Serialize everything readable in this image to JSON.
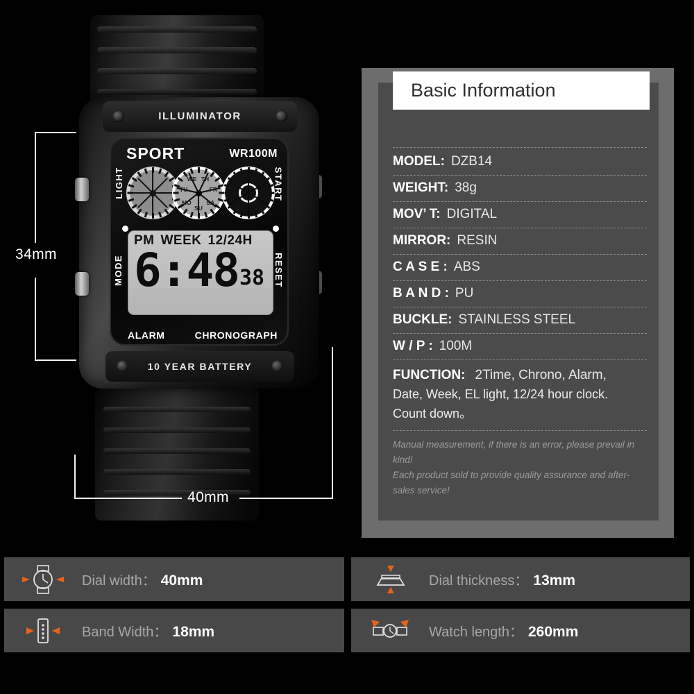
{
  "watch": {
    "bezel_top_text": "ILLUMINATOR",
    "bezel_bottom_text": "10 YEAR BATTERY",
    "face": {
      "brand": "SPORT",
      "water_resist": "WR100M",
      "button_light": "LIGHT",
      "button_start": "START",
      "button_mode": "MODE",
      "button_reset": "RESET",
      "label_alarm": "ALARM",
      "label_chronograph": "CHRONOGRAPH",
      "lcd": {
        "meridiem": "PM",
        "week_label": "WEEK",
        "format_label": "12/24H",
        "time": "6:48",
        "seconds": "38"
      },
      "weekdays": [
        "SU",
        "MO",
        "TU",
        "WE",
        "TH",
        "FR",
        "SA"
      ]
    },
    "dimensions": {
      "height_label": "34mm",
      "width_label": "40mm"
    }
  },
  "spec_panel": {
    "title": "Basic Information",
    "rows": [
      {
        "key": "MODEL:",
        "value": "DZB14"
      },
      {
        "key": "WEIGHT:",
        "value": "38g"
      },
      {
        "key": "MOV’ T:",
        "value": "DIGITAL"
      },
      {
        "key": "MIRROR:",
        "value": "RESIN"
      },
      {
        "key": "C A S E :",
        "value": "ABS"
      },
      {
        "key": "B A N D :",
        "value": "PU"
      },
      {
        "key": "BUCKLE:",
        "value": "STAINLESS STEEL"
      },
      {
        "key": "W / P :",
        "value": "100M"
      }
    ],
    "function": {
      "key": "FUNCTION:",
      "line1": "2Time, Chrono, Alarm,",
      "line2": "Date, Week, EL light, 12/24 hour clock.",
      "line3": "Count down。"
    },
    "notes": [
      "Manual measurement, if there is an error, please prevail in kind!",
      "Each product sold to provide quality assurance and after-sales service!"
    ]
  },
  "measurement_cards": [
    {
      "icon": "watch-dial-icon",
      "label": "Dial width：",
      "value": "40mm"
    },
    {
      "icon": "watch-profile-icon",
      "label": "Dial thickness：",
      "value": "13mm"
    },
    {
      "icon": "watch-band-icon",
      "label": "Band Width：",
      "value": "18mm"
    },
    {
      "icon": "watch-length-icon",
      "label": "Watch length：",
      "value": "260mm"
    }
  ],
  "colors": {
    "background": "#000000",
    "panel_frame": "#6d6d6d",
    "panel_inner": "#4b4b4b",
    "card_background": "#484848",
    "accent_orange": "#e8641c",
    "title_background": "#ffffff"
  }
}
